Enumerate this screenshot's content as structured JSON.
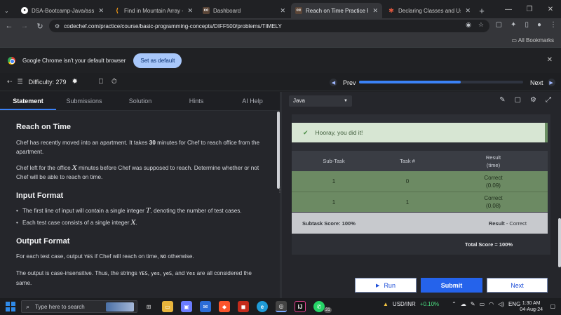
{
  "browser": {
    "tabs": [
      {
        "title": "DSA-Bootcamp-Java/assign",
        "favicon": "github-icon",
        "color": "#ffffff",
        "active": false
      },
      {
        "title": "Find in Mountain Array - Le",
        "favicon": "leetcode-icon",
        "color": "#ffa116",
        "active": false
      },
      {
        "title": "Dashboard",
        "favicon": "codechef-icon",
        "color": "#5b4638",
        "active": false
      },
      {
        "title": "Reach on Time Practice Prob",
        "favicon": "codechef-icon",
        "color": "#5b4638",
        "active": true
      },
      {
        "title": "Declaring Classes and Using",
        "favicon": "generic-icon",
        "color": "#e2583e",
        "active": false
      }
    ],
    "url": "codechef.com/practice/course/basic-programming-concepts/DIFF500/problems/TIMELY",
    "bookmarks_label": "All Bookmarks",
    "infobar_message": "Google Chrome isn't your default browser",
    "infobar_button": "Set as default"
  },
  "header": {
    "difficulty_label": "Difficulty:",
    "difficulty_value": "279",
    "prev_label": "Prev",
    "next_label": "Next",
    "progress_fraction": 0.62
  },
  "left_tabs": [
    "Statement",
    "Submissions",
    "Solution",
    "Hints",
    "AI Help"
  ],
  "problem": {
    "title": "Reach on Time",
    "p1_pre": "Chef has recently moved into an apartment. It takes ",
    "p1_num": "30",
    "p1_post": " minutes for Chef to reach office from the apartment.",
    "p2_pre": "Chef left for the office ",
    "p2_var": "X",
    "p2_post": " minutes before Chef was supposed to reach. Determine whether or not Chef will be able to reach on time.",
    "input_heading": "Input Format",
    "input_1_pre": "The first line of input will contain a single integer ",
    "input_1_var": "T",
    "input_1_post": ", denoting the number of test cases.",
    "input_2_pre": "Each test case consists of a single integer ",
    "input_2_var": "X",
    "input_2_post": ".",
    "output_heading": "Output Format",
    "out_1_pre": "For each test case, output ",
    "out_1_code1": "YES",
    "out_1_mid": " if Chef will reach on time, ",
    "out_1_code2": "NO",
    "out_1_post": " otherwise.",
    "out_2_pre": "The output is case-insensitive. Thus, the strings ",
    "out_2_c1": "YES",
    "out_2_c2": "yes",
    "out_2_c3": "yeS",
    "out_2_c4": "Yes",
    "out_2_post": " are all considered the same."
  },
  "editor": {
    "language": "Java"
  },
  "result": {
    "success_message": "Hooray, you did it!",
    "columns": [
      "Sub-Task",
      "Task #",
      "Result",
      "(time)"
    ],
    "rows": [
      {
        "subtask": "1",
        "task": "0",
        "result": "Correct",
        "time": "(0.09)"
      },
      {
        "subtask": "1",
        "task": "1",
        "result": "Correct",
        "time": "(0.08)"
      }
    ],
    "subtask_score": "Subtask Score: 100%",
    "result_label": "Result",
    "result_value": " - Correct",
    "total_score": "Total Score = 100%"
  },
  "actions": {
    "run": "Run",
    "submit": "Submit",
    "next": "Next"
  },
  "taskbar": {
    "search_placeholder": "Type here to search",
    "ticker_name": "USD/INR",
    "ticker_change": "+0.10%",
    "language": "ENG",
    "time": "1:30 AM",
    "date": "04-Aug-24",
    "whatsapp_badge": "31"
  }
}
